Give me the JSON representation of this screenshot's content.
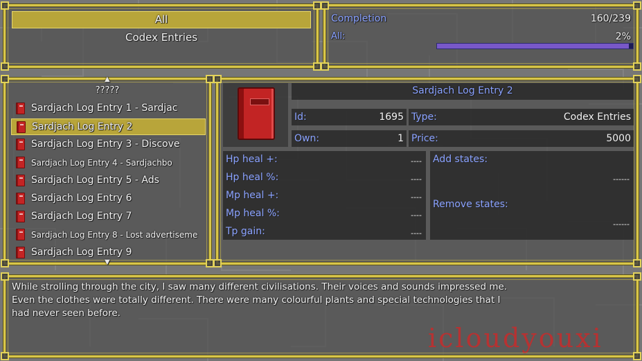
{
  "category": {
    "selected": "All",
    "type_label": "Codex Entries"
  },
  "completion": {
    "label": "Completion",
    "count": "160/239",
    "all_label": "All:",
    "percent_text": "2%",
    "progress": 0.98
  },
  "list": {
    "title": "?????",
    "items": [
      {
        "label": "Sardjach Log Entry 1 - Sardjac",
        "selected": false
      },
      {
        "label": "Sardjach Log Entry 2",
        "selected": true
      },
      {
        "label": "Sardjach Log Entry 3 - Discove",
        "selected": false
      },
      {
        "label": "Sardjach Log Entry 4 - Sardjachbo",
        "selected": false
      },
      {
        "label": "Sardjach Log Entry 5 - Ads",
        "selected": false
      },
      {
        "label": "Sardjach Log Entry 6",
        "selected": false
      },
      {
        "label": "Sardjach Log Entry 7",
        "selected": false
      },
      {
        "label": "Sardjach Log Entry 8 - Lost advertiseme",
        "selected": false
      },
      {
        "label": "Sardjach Log Entry 9",
        "selected": false
      }
    ]
  },
  "detail": {
    "title": "Sardjach Log Entry 2",
    "id_label": "Id:",
    "id_value": "1695",
    "type_label": "Type:",
    "type_value": "Codex Entries",
    "own_label": "Own:",
    "own_value": "1",
    "price_label": "Price:",
    "price_value": "5000",
    "stats": [
      {
        "label": "Hp heal +:",
        "value": "----"
      },
      {
        "label": "Hp heal %:",
        "value": "----"
      },
      {
        "label": "Mp heal +:",
        "value": "----"
      },
      {
        "label": "Mp heal %:",
        "value": "----"
      },
      {
        "label": "Tp gain:",
        "value": "----"
      }
    ],
    "add_states_label": "Add states:",
    "add_states_value": "------",
    "remove_states_label": "Remove states:",
    "remove_states_value": "------"
  },
  "description": {
    "lines": [
      "While strolling through the city, I saw many different civilisations. Their voices and sounds impressed me.",
      "Even the clothes were totally different. There were many colourful plants and special technologies that I",
      "had never seen before."
    ]
  },
  "watermark": "icloudyouxi",
  "colors": {
    "frame": "#d8c64a",
    "highlight": "#b8a53a",
    "label_blue": "#8aa2ff",
    "progress_track": "#1c1c54",
    "progress_fill": "#7858c8"
  },
  "icons": {
    "item": "red-book-icon",
    "scroll_up": "triangle-up-icon",
    "scroll_down": "triangle-down-icon"
  }
}
